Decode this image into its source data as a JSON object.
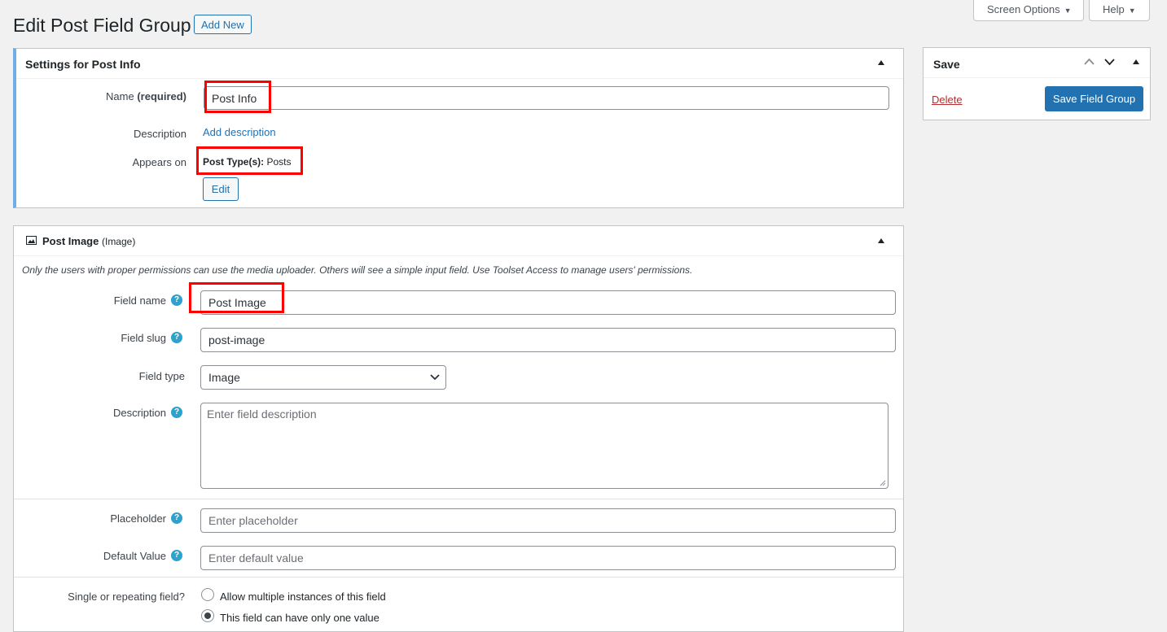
{
  "header": {
    "title": "Edit Post Field Group",
    "add_new": "Add New",
    "screen_options": "Screen Options",
    "help": "Help"
  },
  "settings": {
    "title": "Settings for Post Info",
    "name_label": "Name",
    "name_required": "(required)",
    "name_value": "Post Info",
    "description_label": "Description",
    "add_description": "Add description",
    "appears_on_label": "Appears on",
    "post_types_label": "Post Type(s):",
    "post_types_value": "Posts",
    "edit_button": "Edit"
  },
  "field": {
    "title": "Post Image",
    "type_suffix": "(Image)",
    "notice": "Only the users with proper permissions can use the media uploader. Others will see a simple input field. Use Toolset Access to manage users' permissions.",
    "field_name_label": "Field name",
    "field_name_value": "Post Image",
    "field_slug_label": "Field slug",
    "field_slug_value": "post-image",
    "field_type_label": "Field type",
    "field_type_value": "Image",
    "description_label": "Description",
    "description_placeholder": "Enter field description",
    "placeholder_label": "Placeholder",
    "placeholder_placeholder": "Enter placeholder",
    "default_label": "Default Value",
    "default_placeholder": "Enter default value",
    "repeat_label": "Single or repeating field?",
    "repeat_option_multiple": "Allow multiple instances of this field",
    "repeat_option_single": "This field can have only one value",
    "help_glyph": "?"
  },
  "save": {
    "title": "Save",
    "delete": "Delete",
    "save_button": "Save Field Group"
  },
  "colors": {
    "primary": "#2271b1",
    "highlight": "#ff0000",
    "help": "#2ea2cc",
    "delete": "#b32d2e"
  }
}
